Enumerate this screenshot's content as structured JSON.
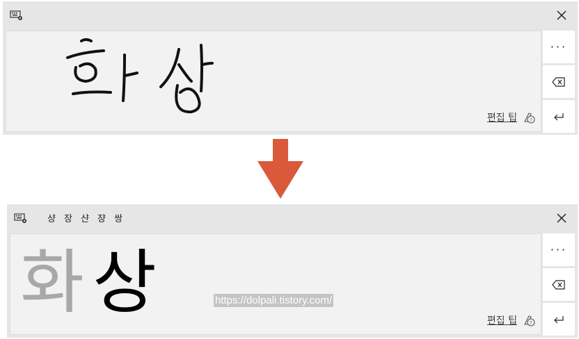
{
  "top_panel": {
    "icon": "keyboard-settings-icon",
    "close_icon": "close-icon",
    "side_buttons": [
      "more-icon",
      "backspace-icon",
      "enter-icon"
    ],
    "more_label": "···",
    "tip_label": "편집 팁",
    "tip_icon": "pen-help-icon",
    "handwriting_icon": "handwritten-strokes-hwa-sang"
  },
  "arrow": {
    "icon": "arrow-down-icon",
    "color": "#d9593a"
  },
  "bottom_panel": {
    "icon": "keyboard-settings-icon",
    "candidates": [
      "샹",
      "장",
      "샨",
      "쟝",
      "쌍"
    ],
    "close_icon": "close-icon",
    "recognized_grey": "화",
    "recognized_black": "상",
    "watermark": "https://dolpali.tistory.com/",
    "more_label": "···",
    "tip_label": "편집 팁",
    "tip_icon": "pen-help-icon"
  },
  "colors": {
    "panel_bg": "#e6e6e6",
    "canvas_bg": "#f2f2f2",
    "grey_char": "#a8a8a8",
    "black_char": "#000000"
  }
}
